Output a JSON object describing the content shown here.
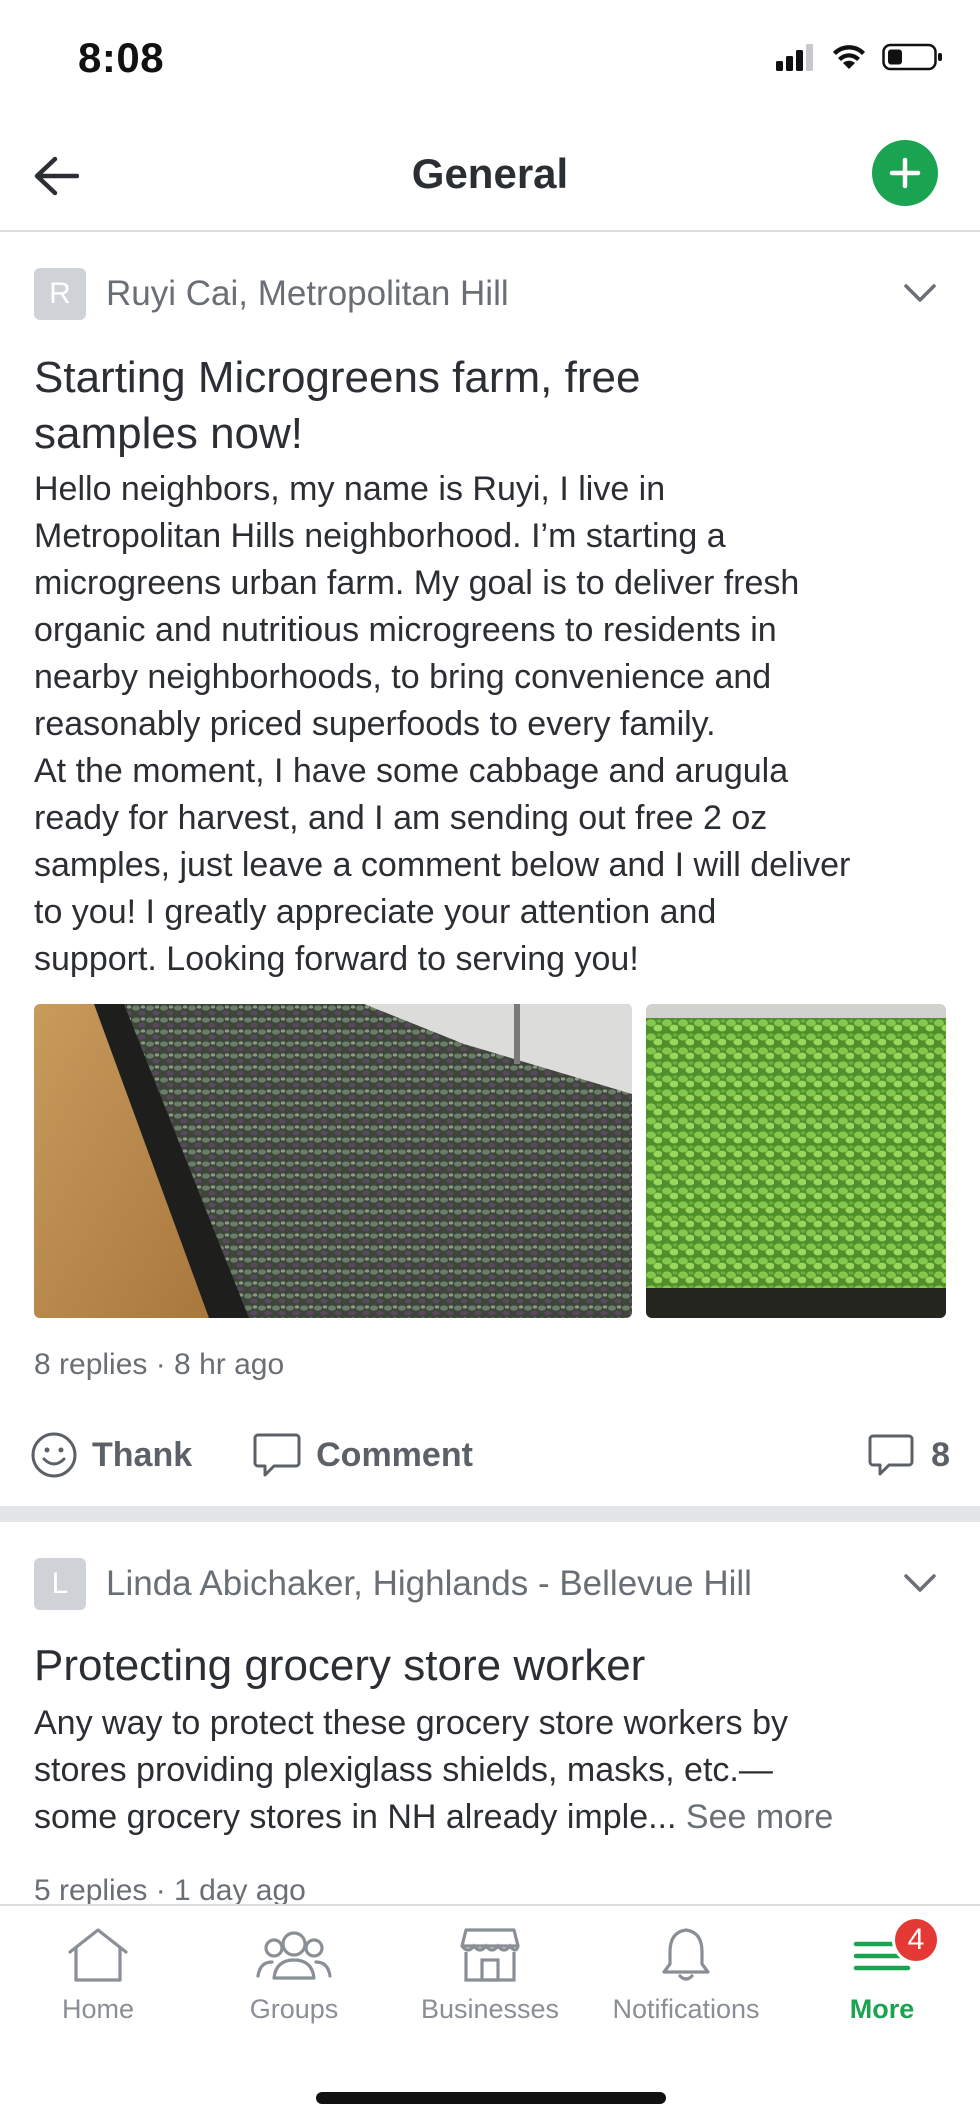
{
  "status_bar": {
    "time": "8:08"
  },
  "header": {
    "title": "General"
  },
  "posts": [
    {
      "avatar_letter": "R",
      "author": "Ruyi Cai, Metropolitan Hill",
      "title_lines": [
        "Starting Microgreens farm, free",
        "samples now!"
      ],
      "body": "Hello neighbors, my name is Ruyi, I live in\nMetropolitan Hills neighborhood. I’m starting a\nmicrogreens urban farm. My goal is to deliver fresh\norganic and nutritious microgreens to residents in\nnearby neighborhoods, to bring convenience and\nreasonably priced superfoods to every family.\nAt the moment, I have some cabbage and arugula\nready for harvest, and I am sending out free 2 oz\nsamples, just leave a comment below and I will deliver\nto you! I greatly appreciate your attention and\nsupport. Looking forward to serving you!",
      "meta": "8 replies · 8 hr ago",
      "thank_label": "Thank",
      "comment_label": "Comment",
      "comment_count": "8"
    },
    {
      "avatar_letter": "L",
      "author": "Linda Abichaker, Highlands - Bellevue Hill",
      "title": "Protecting grocery store worker",
      "body": "Any way to protect these grocery store workers by\nstores providing plexiglass shields, masks, etc.—\nsome grocery stores in NH already imple...",
      "see_more": "See more",
      "meta": "5 replies · 1 day ago"
    }
  ],
  "tabs": [
    {
      "label": "Home",
      "icon": "home-icon"
    },
    {
      "label": "Groups",
      "icon": "groups-icon"
    },
    {
      "label": "Businesses",
      "icon": "storefront-icon"
    },
    {
      "label": "Notifications",
      "icon": "bell-icon"
    },
    {
      "label": "More",
      "icon": "menu-icon",
      "badge": "4"
    }
  ],
  "colors": {
    "accent": "#1aa350",
    "badge": "#e53935",
    "muted": "#6a6f76"
  }
}
